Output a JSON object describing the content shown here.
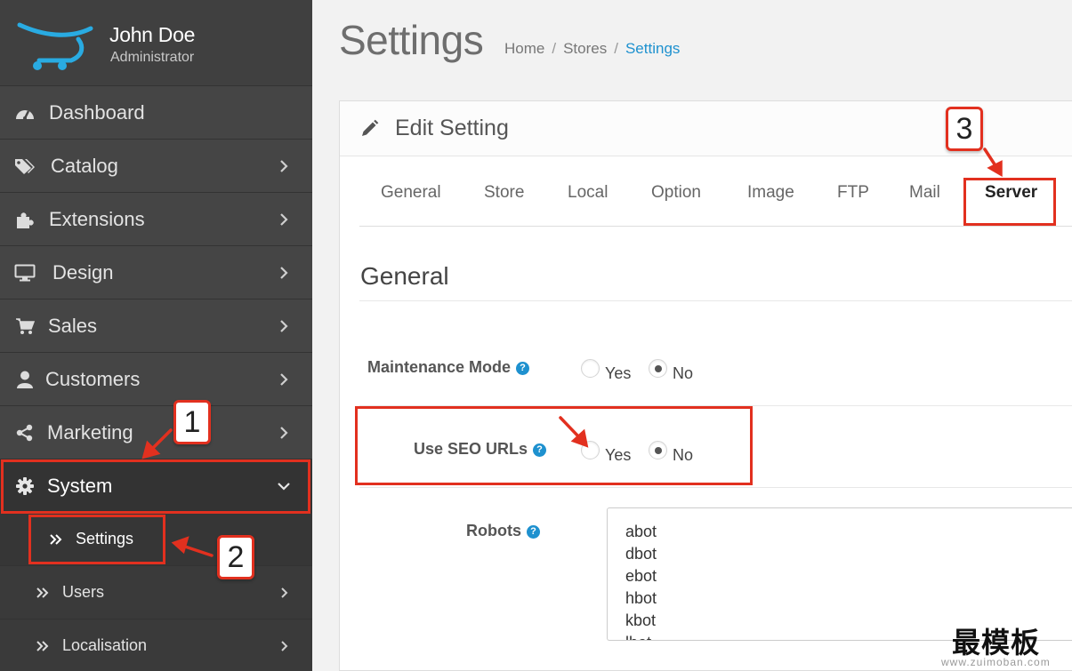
{
  "profile": {
    "name": "John Doe",
    "role": "Administrator"
  },
  "sidebar": {
    "items": [
      {
        "label": "Dashboard",
        "icon": "dashboard-icon",
        "has_chevron": false
      },
      {
        "label": "Catalog",
        "icon": "tags-icon",
        "has_chevron": true
      },
      {
        "label": "Extensions",
        "icon": "puzzle-icon",
        "has_chevron": true
      },
      {
        "label": "Design",
        "icon": "desktop-icon",
        "has_chevron": true
      },
      {
        "label": "Sales",
        "icon": "cart-icon",
        "has_chevron": true
      },
      {
        "label": "Customers",
        "icon": "user-icon",
        "has_chevron": true
      },
      {
        "label": "Marketing",
        "icon": "share-icon",
        "has_chevron": true
      },
      {
        "label": "System",
        "icon": "gear-icon",
        "has_chevron": true,
        "expanded": true
      }
    ],
    "subitems": [
      {
        "label": "Settings",
        "icon": "double-chevron-right-icon",
        "active": true
      },
      {
        "label": "Users",
        "icon": "double-chevron-right-icon",
        "has_chevron": true
      },
      {
        "label": "Localisation",
        "icon": "double-chevron-right-icon",
        "has_chevron": true
      }
    ]
  },
  "header": {
    "title": "Settings",
    "breadcrumb": [
      "Home",
      "Stores",
      "Settings"
    ],
    "breadcrumb_sep": "/"
  },
  "panel": {
    "title": "Edit Setting",
    "tabs": [
      "General",
      "Store",
      "Local",
      "Option",
      "Image",
      "FTP",
      "Mail",
      "Server"
    ],
    "active_tab": "Server",
    "section_title": "General",
    "fields": {
      "maintenance": {
        "label": "Maintenance Mode",
        "yes": "Yes",
        "no": "No",
        "value": "No"
      },
      "seo": {
        "label": "Use SEO URLs",
        "yes": "Yes",
        "no": "No",
        "value": "No"
      },
      "robots": {
        "label": "Robots",
        "lines": [
          "abot",
          "dbot",
          "ebot",
          "hbot",
          "kbot",
          "lbot"
        ]
      }
    },
    "help_glyph": "?"
  },
  "annotations": {
    "step1": "1",
    "step2": "2",
    "step3": "3",
    "color": "#e2301f"
  },
  "watermark": {
    "text": "最模板",
    "url": "www.zuimoban.com"
  }
}
